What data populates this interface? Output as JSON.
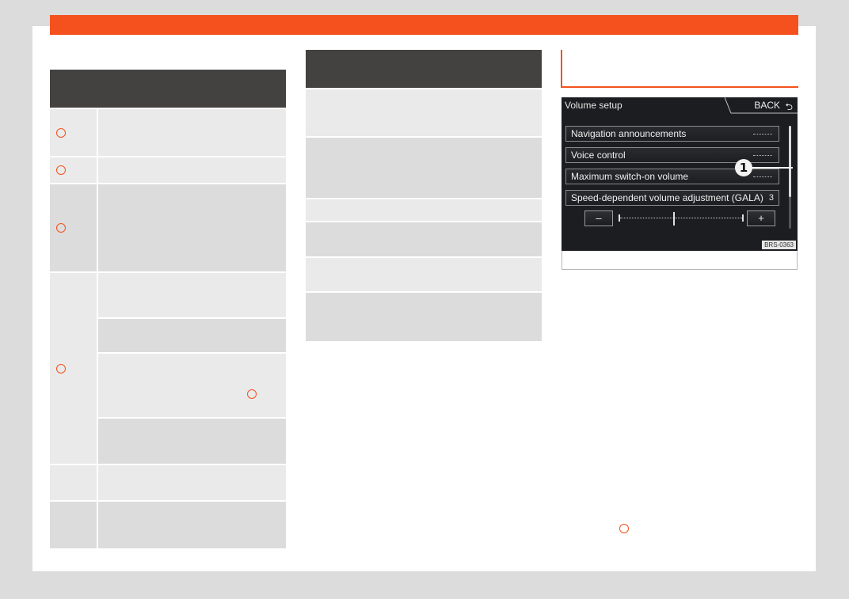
{
  "brand_color": "#f4511e",
  "figure": {
    "screen_title": "Volume setup",
    "back_label": "BACK",
    "back_icon": "return-arrow-icon",
    "menu_items": [
      "Navigation announcements",
      "Voice control",
      "Maximum switch-on volume",
      "Speed-dependent volume adjustment (GALA)"
    ],
    "gala_value": "3",
    "minus_label": "–",
    "plus_label": "+",
    "callout_number": "1",
    "code": "BRS-0363"
  }
}
